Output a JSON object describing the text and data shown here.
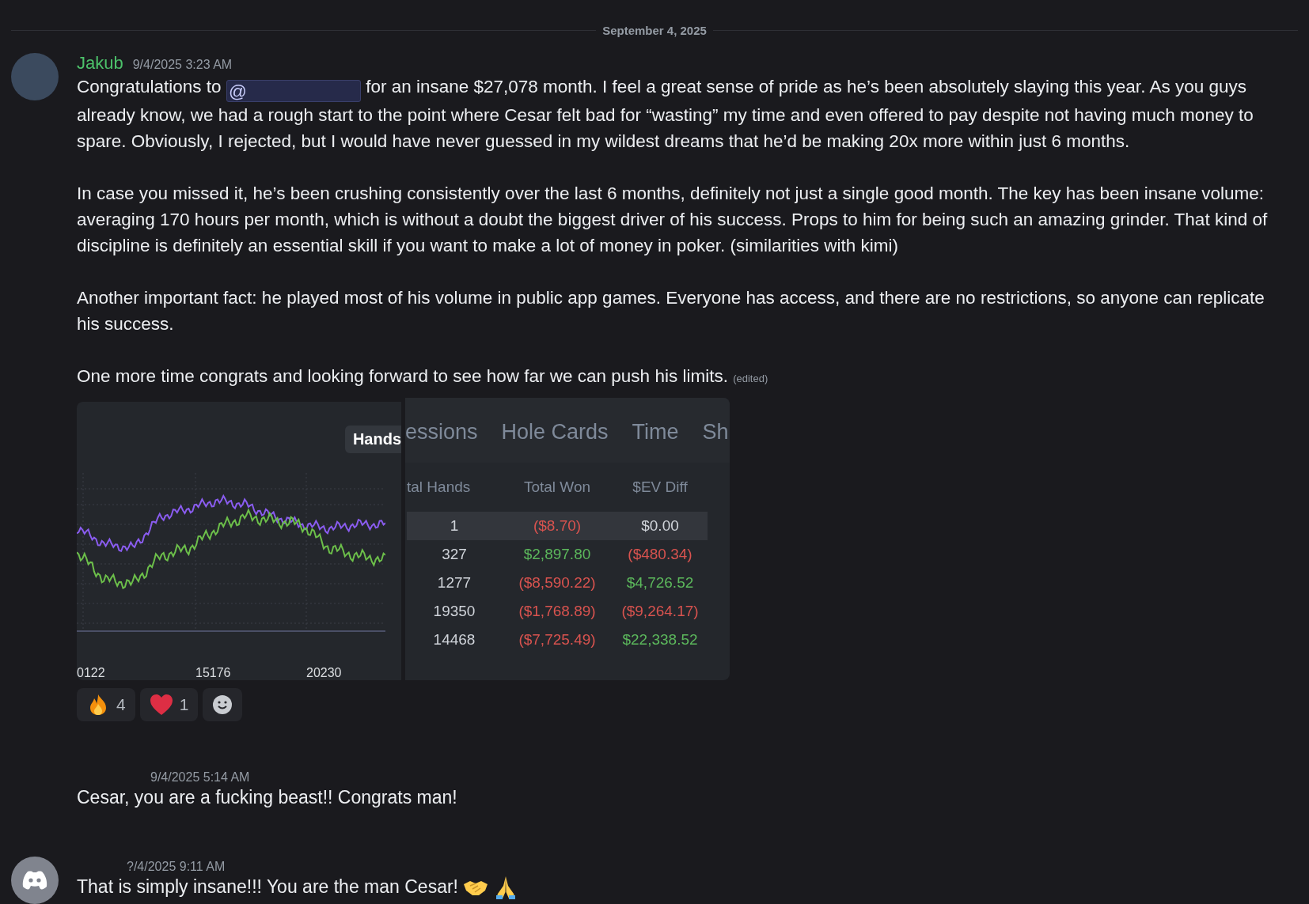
{
  "date_divider": "September 4, 2025",
  "messages": [
    {
      "kind": "full",
      "avatar": {
        "kind": "photo"
      },
      "author": "Jakub",
      "timestamp": "9/4/2025 3:23 AM",
      "paragraphs": [
        {
          "before": "Congratulations to",
          "mention": "@",
          "after": "for an insane $27,078 month. I feel a great sense of pride as he’s been absolutely slaying this year. As you guys already know, we had a rough start to the point where Cesar felt bad for “wasting” my time and even offered to pay despite not having much money to spare. Obviously, I rejected, but I would have never guessed in my wildest dreams that he’d be making 20x more within just 6 months."
        },
        {
          "before": "In case you missed it, he’s been crushing consistently over the last 6 months, definitely not just a single good month. The key has been insane volume: averaging 170 hours per month, which is without a doubt the biggest driver of his success. Props to him for being such an amazing grinder. That kind of discipline is definitely an essential skill if you want to make a lot of money in poker. (similarities with kimi)"
        },
        {
          "before": "Another important fact: he played most of his volume in public app games. Everyone has access, and there are no restrictions, so anyone can replicate his success."
        },
        {
          "before": "One more time congrats and looking forward to see how far we can push his limits.",
          "edited": "(edited)"
        }
      ],
      "chart_image": {
        "button": "Hands",
        "x_labels": [
          "0122",
          "15176",
          "20230"
        ]
      },
      "table_image": {
        "tabs": [
          "essions",
          "Hole Cards",
          "Time",
          "Sh"
        ],
        "columns": [
          "tal Hands",
          "Total Won",
          "$EV Diff"
        ],
        "rows": [
          {
            "selected": true,
            "cells": [
              {
                "text": "1",
                "color": "#d0d4da"
              },
              {
                "text": "($8.70)",
                "color": "#d9534f"
              },
              {
                "text": "$0.00",
                "color": "#d0d4da"
              }
            ]
          },
          {
            "selected": false,
            "cells": [
              {
                "text": "327",
                "color": "#d0d4da"
              },
              {
                "text": "$2,897.80",
                "color": "#5cb85c"
              },
              {
                "text": "($480.34)",
                "color": "#d9534f"
              }
            ]
          },
          {
            "selected": false,
            "cells": [
              {
                "text": "1277",
                "color": "#d0d4da"
              },
              {
                "text": "($8,590.22)",
                "color": "#d9534f"
              },
              {
                "text": "$4,726.52",
                "color": "#5cb85c"
              }
            ]
          },
          {
            "selected": false,
            "cells": [
              {
                "text": "19350",
                "color": "#d0d4da"
              },
              {
                "text": "($1,768.89)",
                "color": "#d9534f"
              },
              {
                "text": "($9,264.17)",
                "color": "#d9534f"
              }
            ]
          },
          {
            "selected": false,
            "cells": [
              {
                "text": "14468",
                "color": "#d0d4da"
              },
              {
                "text": "($7,725.49)",
                "color": "#d9534f"
              },
              {
                "text": "$22,338.52",
                "color": "#5cb85c"
              }
            ]
          }
        ]
      },
      "reactions": [
        {
          "kind": "fire",
          "count": "4"
        },
        {
          "kind": "heart",
          "count": "1"
        },
        {
          "kind": "add"
        }
      ]
    },
    {
      "kind": "bare",
      "timestamp": "9/4/2025 5:14 AM",
      "text": "Cesar, you are a fucking beast!! Congrats man!"
    },
    {
      "kind": "bare",
      "avatar": {
        "kind": "default"
      },
      "timestamp": "?/4/2025 9:11 AM",
      "text": "That is simply insane!!! You are the man Cesar!",
      "emoji": [
        {
          "kind": "handshake"
        },
        {
          "kind": "pray"
        }
      ]
    }
  ]
}
